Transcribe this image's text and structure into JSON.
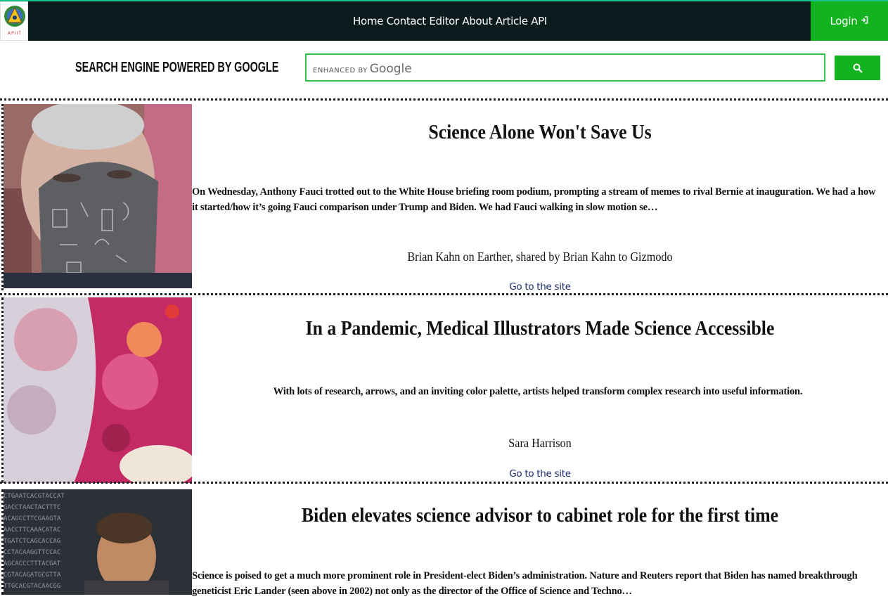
{
  "header": {
    "logo_text": "APIIT",
    "nav": [
      "Home",
      "Contact",
      "Editor",
      "About",
      "Article",
      "API"
    ],
    "login_label": "Login"
  },
  "search": {
    "title": "SEARCH ENGINE POWERED BY GOOGLE",
    "enhanced_by": "ENHANCED BY",
    "google": "Google"
  },
  "articles": [
    {
      "title": "Science Alone Won't Save Us",
      "description": "On Wednesday, Anthony Fauci trotted out to the White House briefing room podium, prompting a stream of memes to rival Bernie at inauguration. We had a how it started/how it’s going Fauci comparison under Trump and Biden. We had Fauci walking in slow motion se…",
      "author": "Brian Kahn on Earther, shared by Brian Kahn to Gizmodo",
      "link": "Go to the site"
    },
    {
      "title": "In a Pandemic, Medical Illustrators Made Science Accessible",
      "description": "With lots of research, arrows, and an inviting color palette, artists helped transform complex research into useful information.",
      "author": "Sara Harrison",
      "link": "Go to the site"
    },
    {
      "title": "Biden elevates science advisor to cabinet role for the first time",
      "description": "Science is poised to get a much more prominent role in President-elect Biden’s administration. Nature and Reuters report that Biden has named breakthrough geneticist Eric Lander (seen above in 2002) not only as the director of the Office of Science and Techno…",
      "author": "",
      "link": ""
    }
  ]
}
